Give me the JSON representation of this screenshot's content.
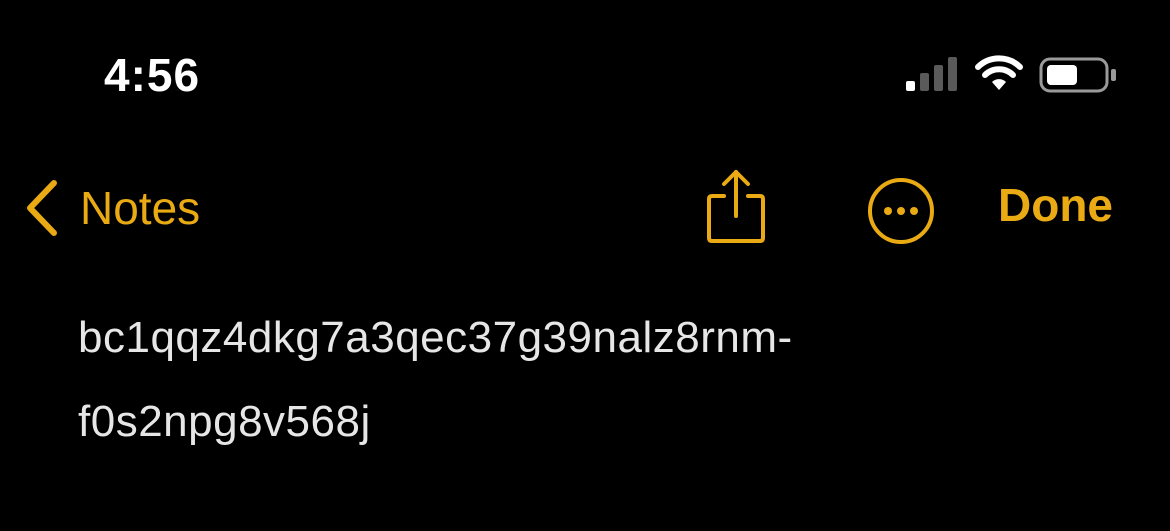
{
  "status_bar": {
    "time": "4:56",
    "icons": [
      "cellular-signal-icon",
      "wifi-icon",
      "battery-icon"
    ]
  },
  "nav": {
    "back_label": "Notes",
    "done_label": "Done",
    "share_icon": "share-icon",
    "more_icon": "more-options-icon"
  },
  "note": {
    "lines": [
      "bc1qqz4dkg7a3qec37g39nalz8rnm-",
      "f0s2npg8v568j"
    ]
  },
  "colors": {
    "accent": "#e9aa14",
    "background": "#000000",
    "text": "#e6e6e6"
  }
}
